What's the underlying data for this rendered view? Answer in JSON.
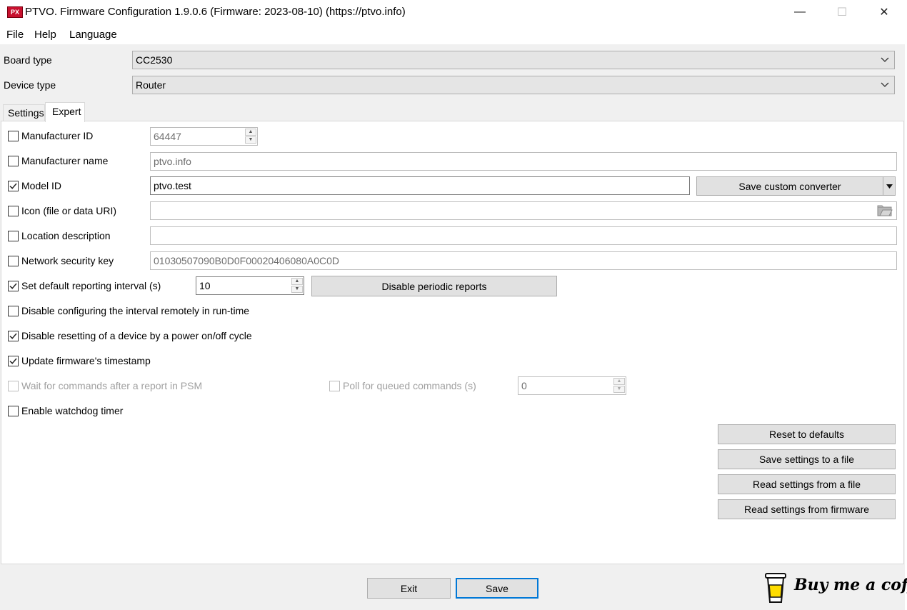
{
  "window": {
    "app_icon_text": "PX",
    "title": "PTVO. Firmware Configuration 1.9.0.6 (Firmware: 2023-08-10) (https://ptvo.info)",
    "minimize_glyph": "—",
    "maximize_glyph": "☐",
    "close_glyph": "✕"
  },
  "menu": {
    "file": "File",
    "help": "Help",
    "language": "Language"
  },
  "board": {
    "label": "Board type",
    "value": "CC2530"
  },
  "device": {
    "label": "Device type",
    "value": "Router"
  },
  "tabs": {
    "settings": "Settings",
    "expert": "Expert",
    "active": "Expert"
  },
  "expert": {
    "manufacturer_id": {
      "label": "Manufacturer ID",
      "checked": false,
      "value": "64447"
    },
    "manufacturer_name": {
      "label": "Manufacturer name",
      "checked": false,
      "value": "ptvo.info"
    },
    "model_id": {
      "label": "Model ID",
      "checked": true,
      "value": "ptvo.test"
    },
    "save_converter": "Save custom converter",
    "icon": {
      "label": "Icon (file or data URI)",
      "checked": false,
      "value": ""
    },
    "location": {
      "label": "Location description",
      "checked": false,
      "value": ""
    },
    "network_key": {
      "label": "Network security key",
      "checked": false,
      "value": "01030507090B0D0F00020406080A0C0D"
    },
    "reporting": {
      "label": "Set default reporting interval (s)",
      "checked": true,
      "value": "10"
    },
    "disable_periodic": "Disable periodic reports",
    "disable_remote": {
      "label": "Disable configuring the interval remotely in run-time",
      "checked": false
    },
    "disable_reset": {
      "label": "Disable resetting of a device by a power on/off cycle",
      "checked": true
    },
    "update_ts": {
      "label": "Update firmware's timestamp",
      "checked": true
    },
    "wait_psm": {
      "label": "Wait for commands after a report in PSM",
      "checked": false,
      "disabled": true
    },
    "poll": {
      "label": "Poll for queued commands (s)",
      "checked": false,
      "disabled": true,
      "value": "0"
    },
    "watchdog": {
      "label": "Enable watchdog timer",
      "checked": false
    },
    "reset_defaults": "Reset to defaults",
    "save_file": "Save settings to a file",
    "read_file": "Read settings from a file",
    "read_firmware": "Read settings from firmware"
  },
  "footer": {
    "exit": "Exit",
    "save": "Save",
    "coffee": "Buy me a coffee"
  }
}
